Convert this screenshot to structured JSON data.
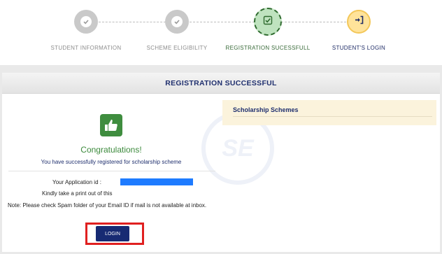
{
  "stepper": {
    "steps": [
      {
        "label": "STUDENT INFORMATION",
        "state": "done",
        "icon": "check-icon"
      },
      {
        "label": "SCHEME ELIGIBILITY",
        "state": "done",
        "icon": "check-icon"
      },
      {
        "label": "REGISTRATION SUCESSFULL",
        "state": "current",
        "icon": "checkbox-icon"
      },
      {
        "label": "STUDENT'S LOGIN",
        "state": "next",
        "icon": "sign-in-icon"
      }
    ]
  },
  "card": {
    "title": "REGISTRATION SUCCESSFUL",
    "congrats": "Congratulations!",
    "success_message": "You have successfully registered for scholarship scheme",
    "application_id_label": "Your Application id :",
    "print_note": "Kindly take a print out of this",
    "spam_note": "Note: Please check Spam folder of your Email ID if mail is not available at inbox.",
    "login_label": "LOGIN"
  },
  "schemes": {
    "title": "Scholarship Schemes"
  },
  "colors": {
    "navy": "#1f2f6e",
    "green": "#3c8a3c",
    "highlight": "#e02020",
    "redacted": "#1e7bff",
    "schemes_bg": "#fbf3dc"
  }
}
